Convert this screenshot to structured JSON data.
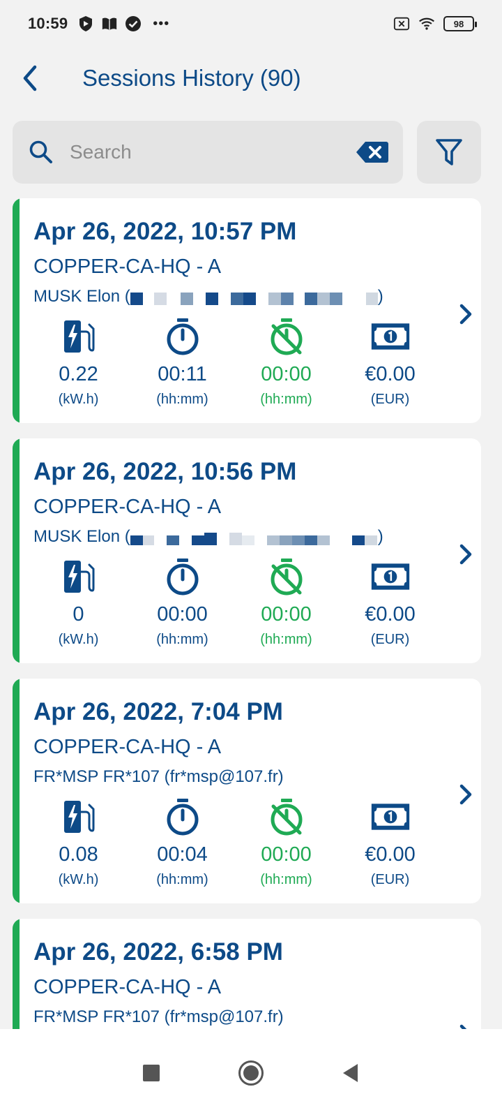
{
  "status_bar": {
    "time": "10:59",
    "battery": "98",
    "more": "•••"
  },
  "header": {
    "title": "Sessions History (90)"
  },
  "search": {
    "placeholder": "Search"
  },
  "colors": {
    "primary": "#0d4a87",
    "accent_green": "#1faa54",
    "card_bg": "#ffffff",
    "page_bg": "#f2f2f2"
  },
  "sessions": [
    {
      "date": "Apr 26, 2022, 10:57 PM",
      "station": "COPPER-CA-HQ - A",
      "user_prefix": "MUSK Elon (",
      "user_suffix": ")",
      "consumption": "0.22",
      "consumption_unit": "(kW.h)",
      "duration": "00:11",
      "duration_unit": "(hh:mm)",
      "inactivity": "00:00",
      "inactivity_unit": "(hh:mm)",
      "price": "€0.00",
      "price_unit": "(EUR)"
    },
    {
      "date": "Apr 26, 2022, 10:56 PM",
      "station": "COPPER-CA-HQ - A",
      "user_prefix": "MUSK Elon (",
      "user_suffix": ")",
      "consumption": "0",
      "consumption_unit": "(kW.h)",
      "duration": "00:00",
      "duration_unit": "(hh:mm)",
      "inactivity": "00:00",
      "inactivity_unit": "(hh:mm)",
      "price": "€0.00",
      "price_unit": "(EUR)"
    },
    {
      "date": "Apr 26, 2022, 7:04 PM",
      "station": "COPPER-CA-HQ - A",
      "user": "FR*MSP FR*107 (fr*msp@107.fr)",
      "consumption": "0.08",
      "consumption_unit": "(kW.h)",
      "duration": "00:04",
      "duration_unit": "(hh:mm)",
      "inactivity": "00:00",
      "inactivity_unit": "(hh:mm)",
      "price": "€0.00",
      "price_unit": "(EUR)"
    },
    {
      "date": "Apr 26, 2022, 6:58 PM",
      "station": "COPPER-CA-HQ - A",
      "user": "FR*MSP FR*107 (fr*msp@107.fr)"
    }
  ]
}
